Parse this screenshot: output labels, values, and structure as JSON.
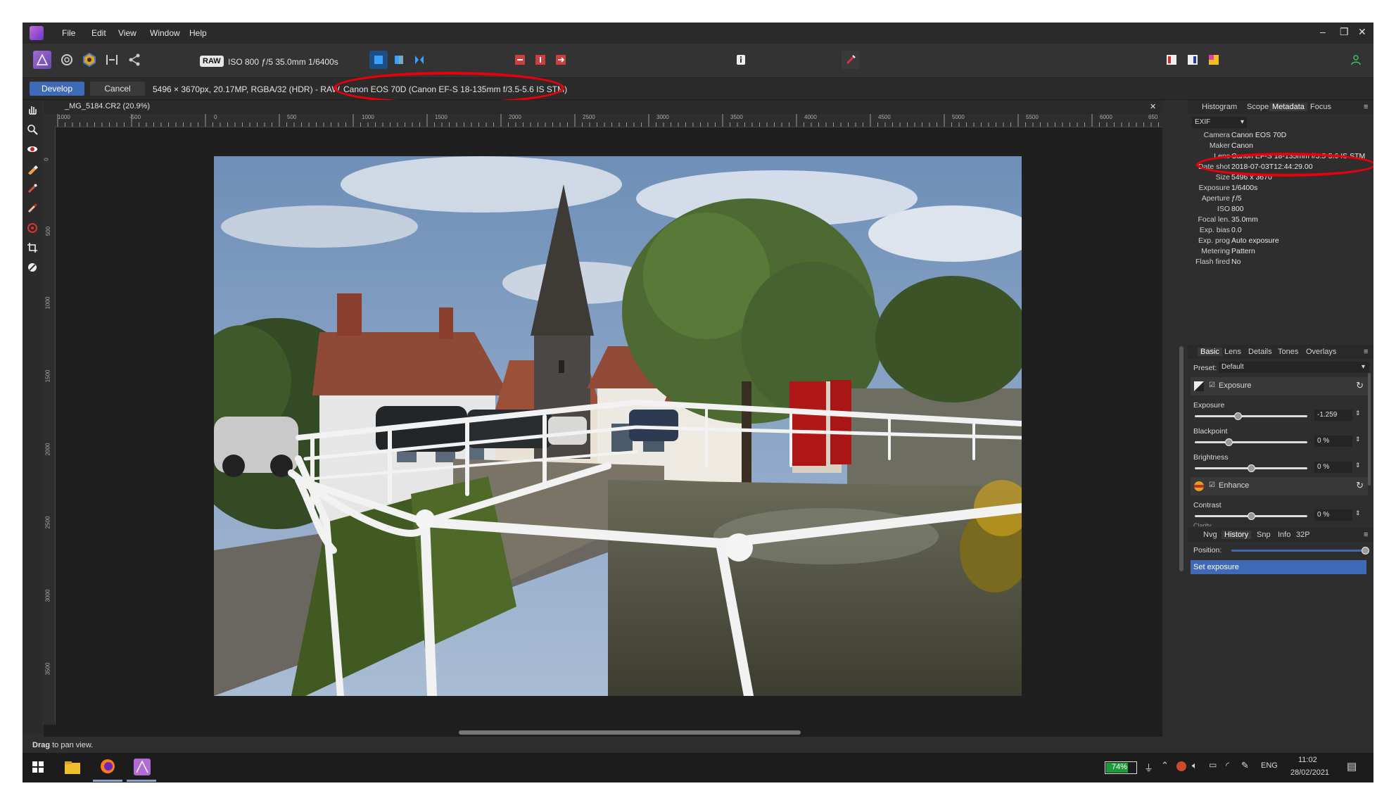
{
  "menubar": {
    "items": [
      "File",
      "Edit",
      "View",
      "Window",
      "Help"
    ],
    "window_controls": [
      "–",
      "❐",
      "✕"
    ]
  },
  "toolbar": {
    "raw_badge": "RAW",
    "exif_summary": "ISO 800 ƒ/5 35.0mm 1/6400s"
  },
  "context": {
    "develop_label": "Develop",
    "cancel_label": "Cancel",
    "image_info": "5496 × 3670px, 20.17MP, RGBA/32 (HDR) - RAW",
    "lens_info": "Canon EOS 70D (Canon EF-S 18-135mm f/3.5-5.6 IS STM)"
  },
  "document": {
    "tab_title": "_MG_5184.CR2 (20.9%)",
    "close_icon": "✕",
    "ruler_h": [
      "1000",
      "-500",
      "0",
      "500",
      "1000",
      "1500",
      "2000",
      "2500",
      "3000",
      "3500",
      "4000",
      "4500",
      "5000",
      "5500",
      "6000",
      "650"
    ],
    "ruler_v": [
      "0",
      "500",
      "1000",
      "1500",
      "2000",
      "2500",
      "3000",
      "3500"
    ]
  },
  "metadata_panel": {
    "tabs": [
      "Histogram",
      "Scope",
      "Metadata",
      "Focus"
    ],
    "active_tab": "Metadata",
    "dropdown": "EXIF",
    "rows": [
      {
        "label": "Camera",
        "value": "Canon EOS 70D"
      },
      {
        "label": "Maker",
        "value": "Canon"
      },
      {
        "label": "Lens",
        "value": "Canon EF-S 18-135mm f/3.5-5.6 IS STM"
      },
      {
        "label": "Date shot",
        "value": "2018-07-03T12:44:29.00"
      },
      {
        "label": "Size",
        "value": "5496 x 3670"
      },
      {
        "label": "Exposure",
        "value": "1/6400s"
      },
      {
        "label": "Aperture",
        "value": "ƒ/5"
      },
      {
        "label": "ISO",
        "value": "800"
      },
      {
        "label": "Focal len.",
        "value": "35.0mm"
      },
      {
        "label": "Exp. bias",
        "value": "0.0"
      },
      {
        "label": "Exp. prog",
        "value": "Auto exposure"
      },
      {
        "label": "Metering",
        "value": "Pattern"
      },
      {
        "label": "Flash fired",
        "value": "No"
      }
    ]
  },
  "develop_panel": {
    "tabs": [
      "Basic",
      "Lens",
      "Details",
      "Tones",
      "Overlays"
    ],
    "active_tab": "Basic",
    "preset_label": "Preset:",
    "preset_value": "Default",
    "exposure_group": "Exposure",
    "sliders_exposure": [
      {
        "label": "Exposure",
        "value": "-1.259",
        "fraction": 0.38
      },
      {
        "label": "Blackpoint",
        "value": "0 %",
        "fraction": 0.3
      },
      {
        "label": "Brightness",
        "value": "0 %",
        "fraction": 0.5
      }
    ],
    "enhance_group": "Enhance",
    "contrast_label": "Contrast",
    "contrast_value": "0 %",
    "contrast_fraction": 0.5,
    "clarity_label": "Clarity"
  },
  "history_panel": {
    "tabs": [
      "Nvg",
      "History",
      "Snp",
      "Info",
      "32P"
    ],
    "active_tab": "History",
    "position_label": "Position:",
    "position_fraction": 1.0,
    "items": [
      "Set exposure"
    ]
  },
  "statusbar": {
    "bold": "Drag",
    "text": " to pan view."
  },
  "taskbar": {
    "battery": "74%",
    "language": "ENG",
    "time": "11:02",
    "date": "28/02/2021"
  },
  "colors": {
    "accent": "#3f6ab8",
    "annotation": "#e8000b",
    "selection": "#3f6ab8"
  }
}
